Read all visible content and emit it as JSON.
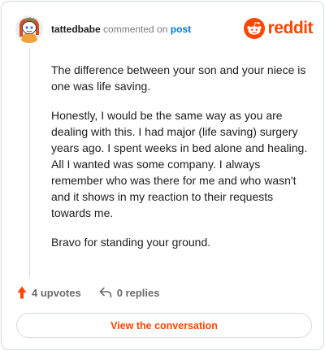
{
  "comment": {
    "author": "tattedbabe",
    "action_text": "commented on",
    "post_link_label": "post",
    "avatar_icon": "snoo-avatar-icon",
    "paragraphs": [
      "The difference between your son and your niece is one was life saving.",
      "Honestly, I would be the same way as you are dealing with this. I had major (life saving) surgery years ago. I spent weeks in bed alone and healing. All I wanted was some company. I always remember who was there for me and who wasn't and it shows in my reaction to their requests towards me.",
      "Bravo for standing your ground."
    ]
  },
  "brand": {
    "wordmark": "reddit",
    "logo_icon": "reddit-logo-icon",
    "color": "#ff4500"
  },
  "actions": {
    "upvote_icon": "upvote-arrow-icon",
    "upvotes_label": "4 upvotes",
    "reply_icon": "reply-arrow-icon",
    "replies_label": "0 replies"
  },
  "cta": {
    "label": "View the conversation"
  }
}
